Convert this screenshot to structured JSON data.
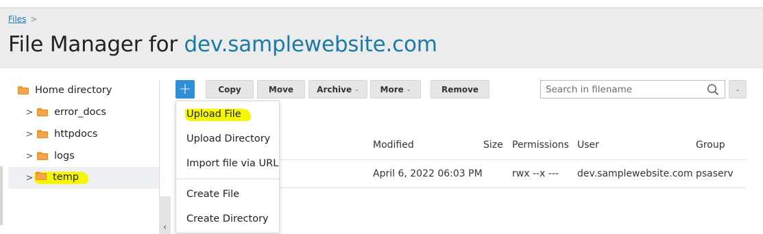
{
  "breadcrumb": {
    "root": "Files",
    "separator": ">"
  },
  "title": {
    "prefix": "File Manager for ",
    "domain": "dev.samplewebsite.com"
  },
  "tree": {
    "items": [
      {
        "label": "Home directory"
      },
      {
        "label": "error_docs"
      },
      {
        "label": "httpdocs"
      },
      {
        "label": "logs"
      },
      {
        "label": "temp"
      }
    ],
    "expander_glyph": ">",
    "collapse_glyph": "‹"
  },
  "toolbar": {
    "add_label": "+",
    "copy_label": "Copy",
    "move_label": "Move",
    "archive_label": "Archive",
    "more_label": "More",
    "remove_label": "Remove",
    "caret_glyph": "⌄"
  },
  "search": {
    "placeholder": "Search in filename"
  },
  "add_menu": {
    "items": [
      {
        "label": "Upload File"
      },
      {
        "label": "Upload Directory"
      },
      {
        "label": "Import file via URL"
      },
      {
        "label": "Create File"
      },
      {
        "label": "Create Directory"
      }
    ]
  },
  "table": {
    "headers": [
      "Modified",
      "Size",
      "Permissions",
      "User",
      "Group"
    ],
    "rows": [
      {
        "modified": "April 6, 2022 06:03 PM",
        "size": "",
        "permissions": "rwx --x ---",
        "user": "dev.samplewebsite.com",
        "group": "psaserv"
      }
    ]
  },
  "colors": {
    "accent": "#2f8fd5",
    "link": "#1a73b5",
    "domain_title": "#1b7ba8",
    "folder": "#f7a54a",
    "highlight": "#f5f700"
  },
  "icons": {
    "folder": "folder-icon",
    "search": "search-icon",
    "chevron_right": "chevron-right-icon",
    "chevron_down": "chevron-down-icon",
    "chevron_left": "chevron-left-icon"
  }
}
